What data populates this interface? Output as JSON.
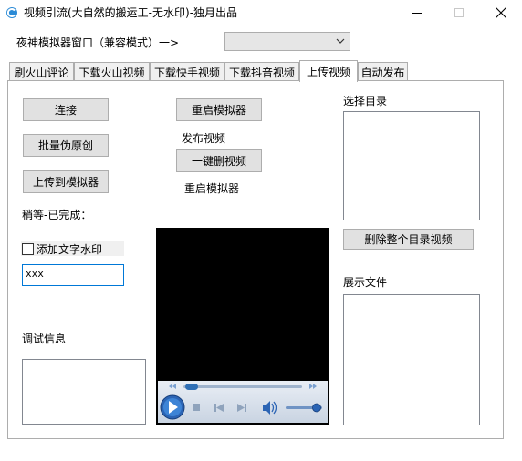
{
  "window": {
    "title": "视频引流(大自然的搬运工-无水印)-独月出品"
  },
  "emulator": {
    "label": "夜神模拟器窗口（兼容模式）一>",
    "selected": ""
  },
  "tabs": [
    {
      "label": "刷火山评论",
      "active": false
    },
    {
      "label": "下载火山视频",
      "active": false
    },
    {
      "label": "下载快手视频",
      "active": false
    },
    {
      "label": "下载抖音视频",
      "active": false
    },
    {
      "label": "上传视频",
      "active": true
    },
    {
      "label": "自动发布",
      "active": false
    }
  ],
  "upload": {
    "connect_label": "连接",
    "batch_fake_label": "批量伪原创",
    "upload_to_emulator_label": "上传到模拟器",
    "wait_status": "稍等-已完成：",
    "watermark_label": "添加文字水印",
    "watermark_checked": false,
    "watermark_text": "xxx",
    "debug_label": "调试信息",
    "restart_emulator_button": "重启模拟器",
    "publish_label": "发布视频",
    "one_click_delete_button": "一键删视频",
    "restart_emulator_text": "重启模拟器",
    "select_dir_label": "选择目录",
    "delete_all_dir_button": "删除整个目录视频",
    "show_files_label": "展示文件"
  },
  "player": {
    "progress": 0.0,
    "volume": 0.85
  },
  "colors": {
    "button_bg": "#e1e1e1",
    "active_tab_bg": "#ffffff",
    "focus_border": "#0078d7",
    "player_bg": "#000000"
  },
  "icons": [
    "app-logo-icon",
    "minimize-icon",
    "maximize-icon",
    "close-icon",
    "chevron-down-icon",
    "play-icon",
    "stop-icon",
    "previous-icon",
    "next-icon",
    "volume-icon",
    "rewind-icon",
    "fast-forward-icon"
  ]
}
